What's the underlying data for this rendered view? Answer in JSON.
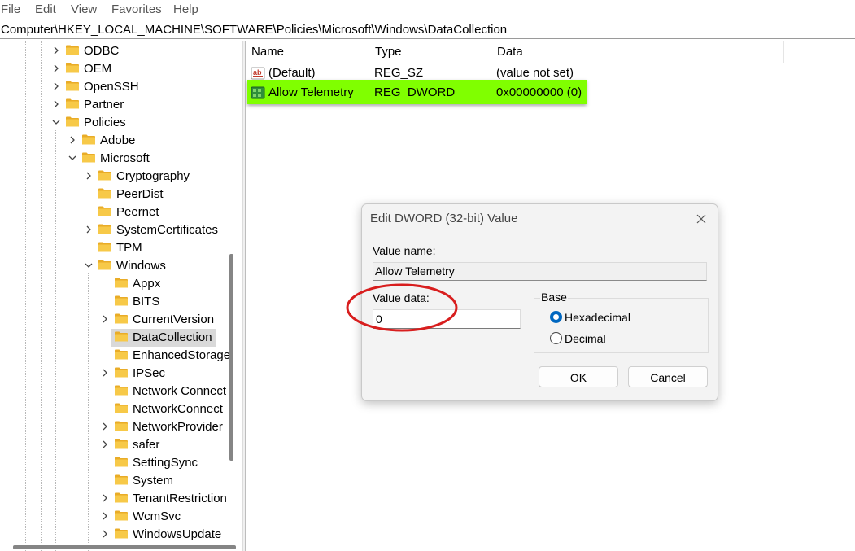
{
  "menu": [
    "File",
    "Edit",
    "View",
    "Favorites",
    "Help"
  ],
  "address": "Computer\\HKEY_LOCAL_MACHINE\\SOFTWARE\\Policies\\Microsoft\\Windows\\DataCollection",
  "tree": {
    "items": [
      {
        "label": "ODBC",
        "expander": "collapsed"
      },
      {
        "label": "OEM",
        "expander": "collapsed"
      },
      {
        "label": "OpenSSH",
        "expander": "collapsed"
      },
      {
        "label": "Partner",
        "expander": "collapsed"
      },
      {
        "label": "Policies",
        "expander": "expanded"
      },
      {
        "label": "Adobe",
        "expander": "collapsed"
      },
      {
        "label": "Microsoft",
        "expander": "expanded"
      },
      {
        "label": "Cryptography",
        "expander": "collapsed"
      },
      {
        "label": "PeerDist",
        "expander": "none"
      },
      {
        "label": "Peernet",
        "expander": "none"
      },
      {
        "label": "SystemCertificates",
        "expander": "collapsed"
      },
      {
        "label": "TPM",
        "expander": "none"
      },
      {
        "label": "Windows",
        "expander": "expanded"
      },
      {
        "label": "Appx",
        "expander": "none"
      },
      {
        "label": "BITS",
        "expander": "none"
      },
      {
        "label": "CurrentVersion",
        "expander": "collapsed"
      },
      {
        "label": "DataCollection",
        "expander": "none",
        "selected": true
      },
      {
        "label": "EnhancedStorage",
        "expander": "none"
      },
      {
        "label": "IPSec",
        "expander": "collapsed"
      },
      {
        "label": "Network Connect",
        "expander": "none"
      },
      {
        "label": "NetworkConnect",
        "expander": "none"
      },
      {
        "label": "NetworkProvider",
        "expander": "collapsed"
      },
      {
        "label": "safer",
        "expander": "collapsed"
      },
      {
        "label": "SettingSync",
        "expander": "none"
      },
      {
        "label": "System",
        "expander": "none"
      },
      {
        "label": "TenantRestriction",
        "expander": "collapsed"
      },
      {
        "label": "WcmSvc",
        "expander": "collapsed"
      },
      {
        "label": "WindowsUpdate",
        "expander": "collapsed"
      }
    ]
  },
  "list": {
    "columns": [
      "Name",
      "Type",
      "Data"
    ],
    "rows": [
      {
        "name": "(Default)",
        "type": "REG_SZ",
        "data": "(value not set)",
        "icon": "string-value-icon"
      },
      {
        "name": "Allow Telemetry",
        "type": "REG_DWORD",
        "data": "0x00000000 (0)",
        "icon": "binary-value-icon",
        "highlight": "#80ff00"
      }
    ]
  },
  "dialog": {
    "title": "Edit DWORD (32-bit) Value",
    "value_name_label": "Value name:",
    "value_name": "Allow Telemetry",
    "value_data_label": "Value data:",
    "value_data": "0",
    "base_label": "Base",
    "base_options": [
      {
        "label": "Hexadecimal",
        "selected": true
      },
      {
        "label": "Decimal",
        "selected": false
      }
    ],
    "ok_label": "OK",
    "cancel_label": "Cancel"
  },
  "colors": {
    "highlight": "#80ff00",
    "annotation": "#d81e1e",
    "accent": "#0067c0",
    "folder": "#f5c33b"
  }
}
